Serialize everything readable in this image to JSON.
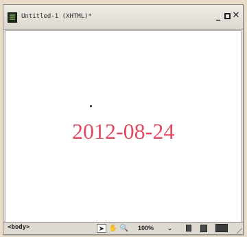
{
  "window": {
    "title": "Untitled-1 (XHTML)*",
    "minimize_glyph": "_",
    "close_glyph": "✕"
  },
  "document": {
    "text": "2012-08-24",
    "text_color": "#e24a61"
  },
  "statusbar": {
    "tag_selector": "<body>",
    "zoom_level": "100%",
    "zoom_arrow": "⌄",
    "tools": {
      "pointer": "➤",
      "hand": "✋",
      "zoom": "🔍"
    }
  },
  "icons": {
    "document": "document-icon",
    "pointer": "pointer-tool-icon",
    "hand": "hand-tool-icon",
    "zoom": "zoom-tool-icon",
    "small_view": "small-view-icon",
    "medium_view": "medium-view-icon",
    "large_view": "large-view-icon"
  }
}
